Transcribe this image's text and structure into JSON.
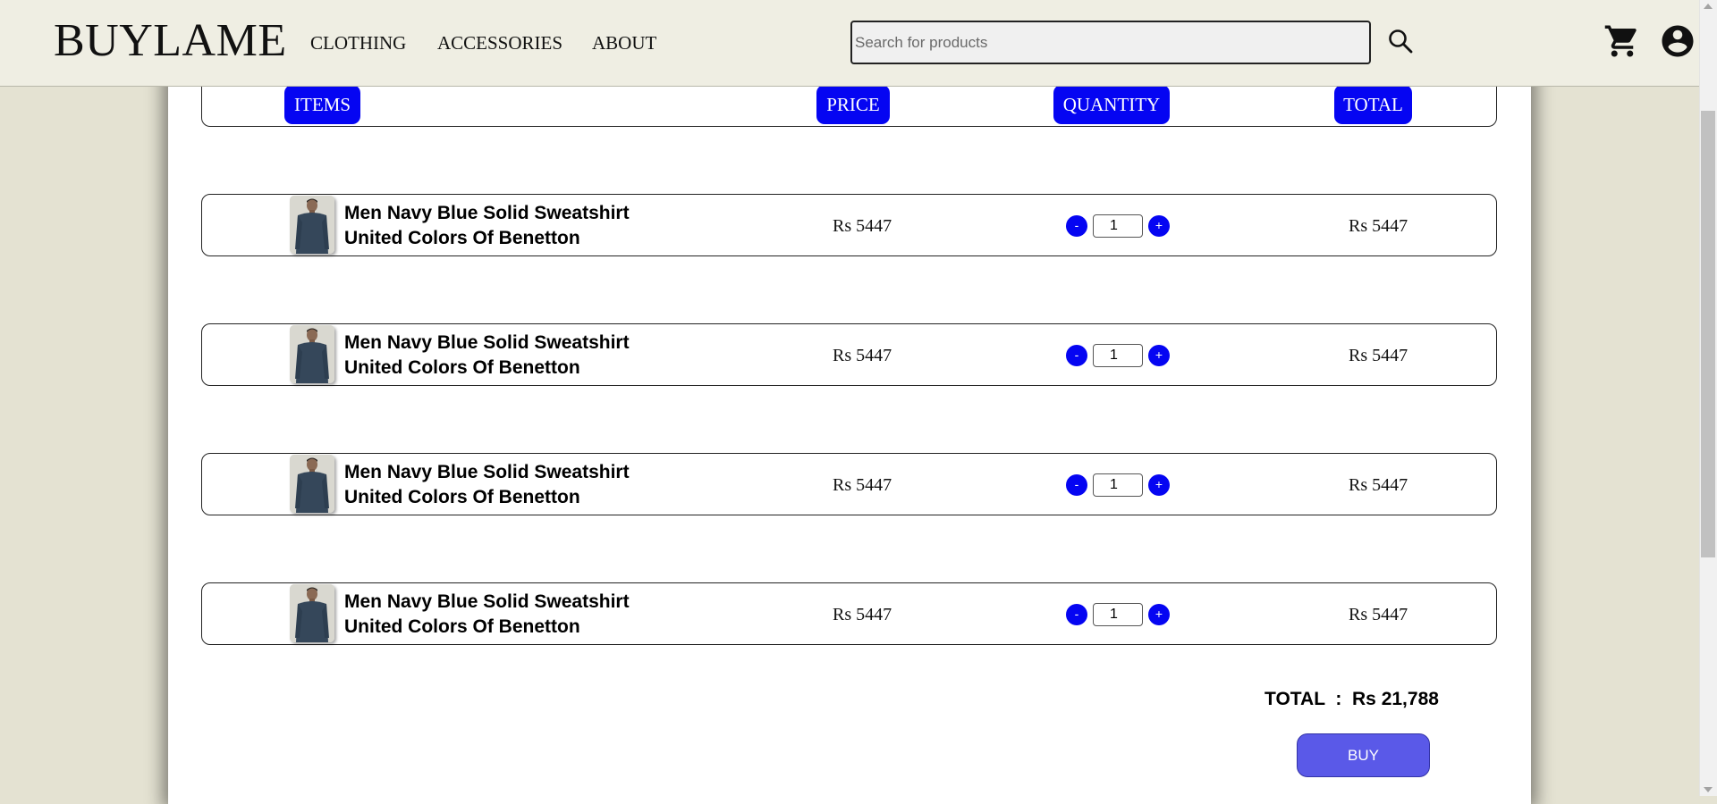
{
  "header": {
    "logo": "BUYLAME",
    "nav": [
      {
        "label": "CLOTHING"
      },
      {
        "label": "ACCESSORIES"
      },
      {
        "label": "ABOUT"
      }
    ],
    "search": {
      "placeholder": "Search for products",
      "value": ""
    },
    "icons": {
      "search": "search-icon",
      "cart": "cart-icon",
      "account": "account-icon"
    }
  },
  "cart": {
    "columns": [
      "ITEMS",
      "PRICE",
      "QUANTITY",
      "TOTAL"
    ],
    "items": [
      {
        "name_line1": "Men Navy Blue Solid Sweatshirt",
        "name_line2": "United Colors Of Benetton",
        "price": "Rs 5447",
        "quantity": "1",
        "total": "Rs 5447"
      },
      {
        "name_line1": "Men Navy Blue Solid Sweatshirt",
        "name_line2": "United Colors Of Benetton",
        "price": "Rs 5447",
        "quantity": "1",
        "total": "Rs 5447"
      },
      {
        "name_line1": "Men Navy Blue Solid Sweatshirt",
        "name_line2": "United Colors Of Benetton",
        "price": "Rs 5447",
        "quantity": "1",
        "total": "Rs 5447"
      },
      {
        "name_line1": "Men Navy Blue Solid Sweatshirt",
        "name_line2": "United Colors Of Benetton",
        "price": "Rs 5447",
        "quantity": "1",
        "total": "Rs 5447"
      }
    ],
    "qty_minus": "-",
    "qty_plus": "+",
    "total_label": "TOTAL",
    "total_separator": ":",
    "total_value": "Rs 21,788",
    "buy_label": "BUY"
  },
  "colors": {
    "accent": "#0505f2",
    "buy_button": "#5a59e8",
    "header_bg": "#efeee3",
    "page_bg": "#e4e2d2"
  }
}
